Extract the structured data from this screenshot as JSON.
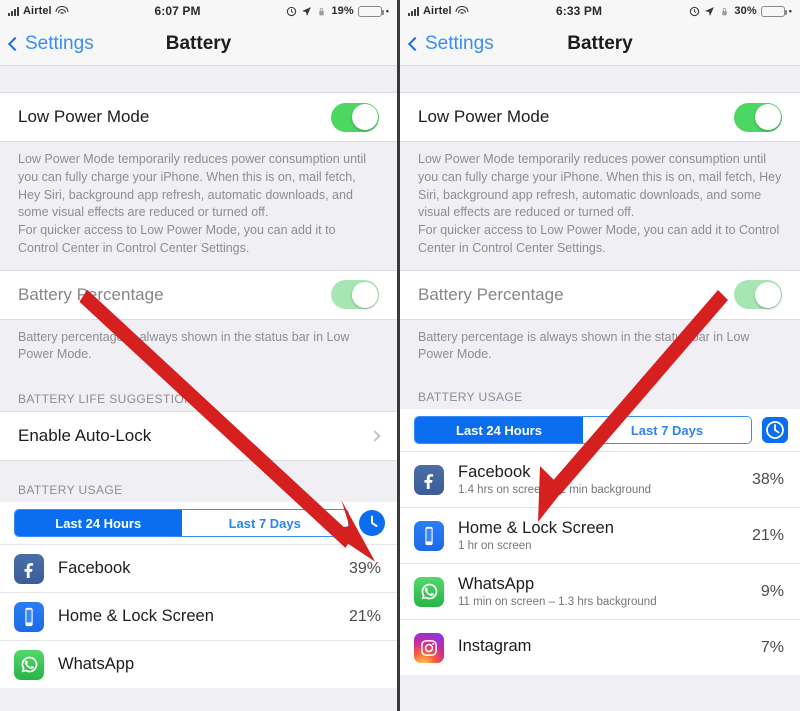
{
  "panels": [
    {
      "id": "left",
      "status": {
        "carrier": "Airtel",
        "time": "6:07 PM",
        "battery_percent": "19%",
        "battery_level": 19,
        "signal_icon": "signal-bars-icon",
        "wifi_icon": "wifi-icon",
        "alarm_icon": "alarm-icon",
        "location_icon": "location-arrow-icon",
        "lock_icon": "rotation-lock-icon",
        "battery_icon": "battery-icon"
      },
      "nav": {
        "back_label": "Settings",
        "back_icon": "chevron-left-icon",
        "title": "Battery"
      },
      "low_power": {
        "label": "Low Power Mode",
        "enabled": true
      },
      "low_power_note_1": "Low Power Mode temporarily reduces power consumption until you can fully charge your iPhone. When this is on, mail fetch, Hey Siri, background app refresh, automatic downloads, and some visual effects are reduced or turned off.",
      "low_power_note_2": "For quicker access to Low Power Mode, you can add it to Control Center in Control Center Settings.",
      "battery_percentage": {
        "label": "Battery Percentage",
        "enabled": true,
        "dimmed": true
      },
      "battery_percentage_note": "Battery percentage is always shown in the status bar in Low Power Mode.",
      "suggestions_header": "BATTERY LIFE SUGGESTIONS",
      "suggestion_item": {
        "label": "Enable Auto-Lock",
        "disclosure_icon": "chevron-right-icon"
      },
      "usage_header": "BATTERY USAGE",
      "segmented": {
        "options": [
          "Last 24 Hours",
          "Last 7 Days"
        ],
        "selected": 0
      },
      "clock_button": {
        "icon": "clock-icon",
        "shape": "round"
      },
      "usage_rows": [
        {
          "app": "Facebook",
          "detail": "",
          "percent": "39%",
          "icon": "facebook-icon"
        },
        {
          "app": "Home & Lock Screen",
          "detail": "",
          "percent": "21%",
          "icon": "home-lock-screen-icon"
        },
        {
          "app": "WhatsApp",
          "detail": "",
          "percent": "",
          "icon": "whatsapp-icon"
        }
      ]
    },
    {
      "id": "right",
      "status": {
        "carrier": "Airtel",
        "time": "6:33 PM",
        "battery_percent": "30%",
        "battery_level": 30,
        "signal_icon": "signal-bars-icon",
        "wifi_icon": "wifi-icon",
        "alarm_icon": "alarm-icon",
        "location_icon": "location-arrow-icon",
        "lock_icon": "rotation-lock-icon",
        "battery_icon": "battery-icon"
      },
      "nav": {
        "back_label": "Settings",
        "back_icon": "chevron-left-icon",
        "title": "Battery"
      },
      "low_power": {
        "label": "Low Power Mode",
        "enabled": true
      },
      "low_power_note_1": "Low Power Mode temporarily reduces power consumption until you can fully charge your iPhone. When this is on, mail fetch, Hey Siri, background app refresh, automatic downloads, and some visual effects are reduced or turned off.",
      "low_power_note_2": "For quicker access to Low Power Mode, you can add it to Control Center in Control Center Settings.",
      "battery_percentage": {
        "label": "Battery Percentage",
        "enabled": true,
        "dimmed": true
      },
      "battery_percentage_note": "Battery percentage is always shown in the status bar in Low Power Mode.",
      "usage_header": "BATTERY USAGE",
      "segmented": {
        "options": [
          "Last 24 Hours",
          "Last 7 Days"
        ],
        "selected": 0
      },
      "clock_button": {
        "icon": "clock-icon",
        "shape": "square"
      },
      "usage_rows": [
        {
          "app": "Facebook",
          "detail": "1.4 hrs on screen – 2 min background",
          "percent": "38%",
          "icon": "facebook-icon"
        },
        {
          "app": "Home & Lock Screen",
          "detail": "1 hr on screen",
          "percent": "21%",
          "icon": "home-lock-screen-icon"
        },
        {
          "app": "WhatsApp",
          "detail": "11 min on screen – 1.3 hrs background",
          "percent": "9%",
          "icon": "whatsapp-icon"
        },
        {
          "app": "Instagram",
          "detail": "",
          "percent": "7%",
          "icon": "instagram-icon"
        }
      ]
    }
  ],
  "annotations": {
    "arrow_color": "#d61f1f",
    "left_arrow": {
      "name": "red-arrow-to-clock-button"
    },
    "right_arrow": {
      "name": "red-arrow-to-facebook-row"
    }
  }
}
